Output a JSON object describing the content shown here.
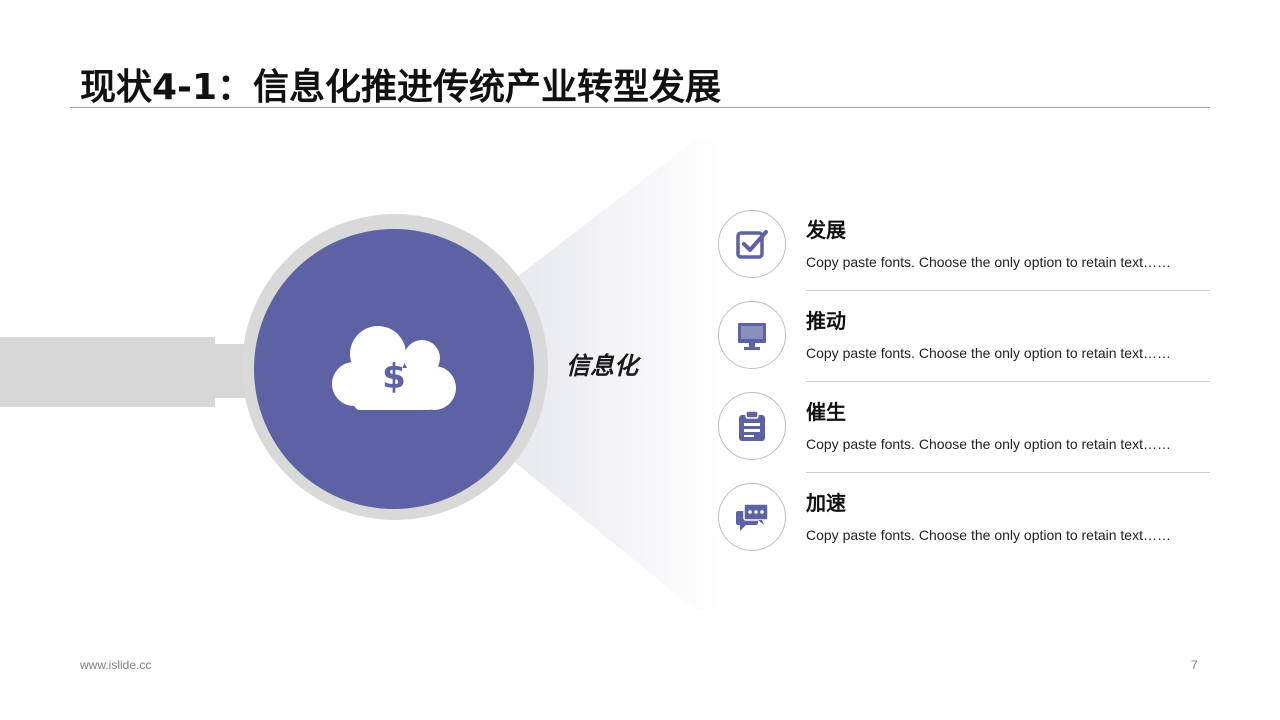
{
  "title": "现状4-1：信息化推进传统产业转型发展",
  "center_label": "信息化",
  "center_icon": "cloud-dollar-icon",
  "colors": {
    "accent": "#5c62a3",
    "ring": "#d9d9d9",
    "handle": "#d7d7d7"
  },
  "items": [
    {
      "title": "发展",
      "desc": "Copy paste fonts. Choose the only option to retain text……",
      "icon": "checkbox-icon"
    },
    {
      "title": "推动",
      "desc": "Copy paste fonts. Choose the only option to retain text……",
      "icon": "monitor-icon"
    },
    {
      "title": "催生",
      "desc": "Copy paste fonts. Choose the only option to retain text……",
      "icon": "clipboard-icon"
    },
    {
      "title": "加速",
      "desc": "Copy paste fonts. Choose the only option to retain text……",
      "icon": "chat-icon"
    }
  ],
  "footer": {
    "url": "www.islide.cc",
    "page": "7"
  }
}
